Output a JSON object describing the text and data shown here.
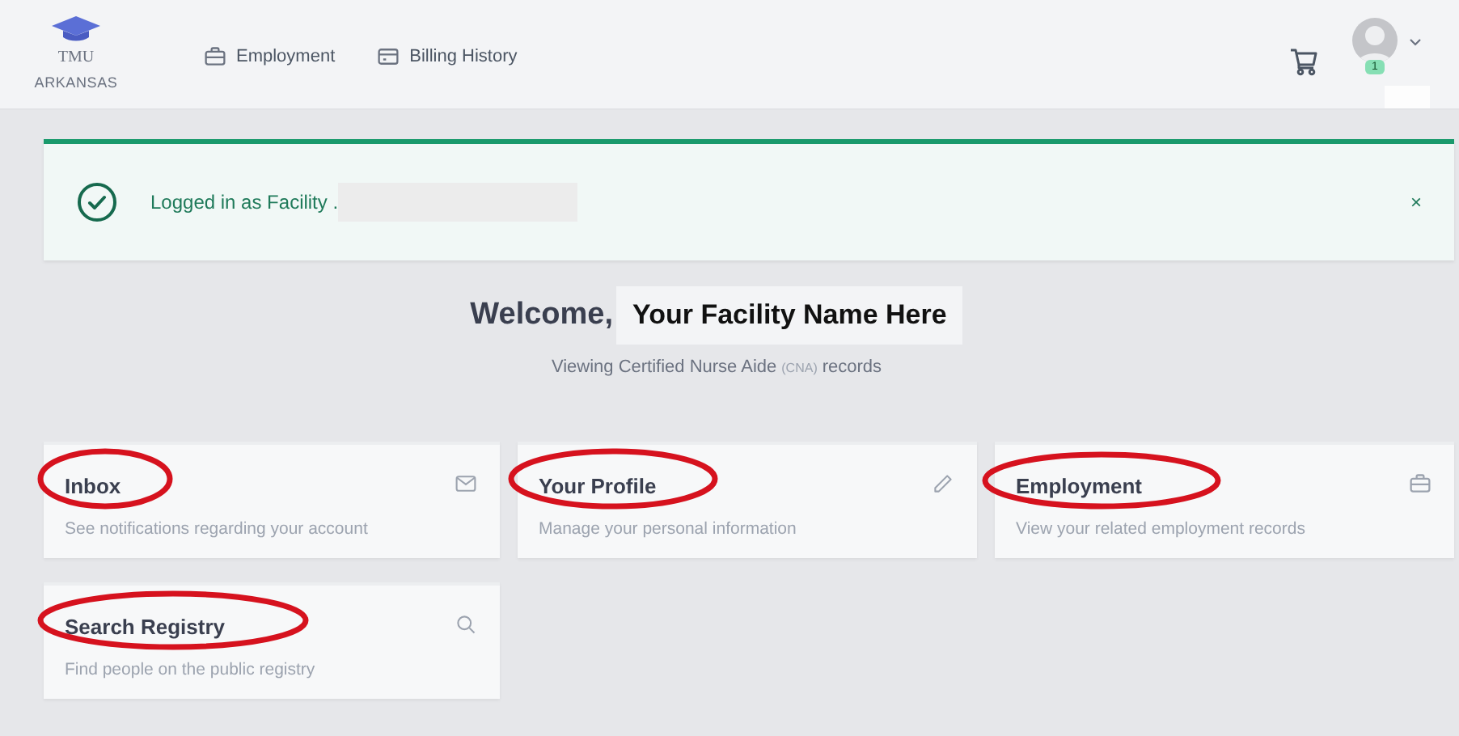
{
  "header": {
    "logo": {
      "title": "TMU",
      "subtitle": "ARKANSAS"
    },
    "nav": [
      {
        "label": "Employment"
      },
      {
        "label": "Billing History"
      }
    ],
    "notifications_badge": "1"
  },
  "alert": {
    "message": "Logged in as Facility .",
    "close_label": "×"
  },
  "welcome": {
    "greeting": "Welcome,",
    "name": "Your Facility Name Here",
    "subtitle_before": "Viewing Certified Nurse Aide",
    "subtitle_abbr": "(CNA)",
    "subtitle_after": "records"
  },
  "cards": [
    {
      "title": "Inbox",
      "description": "See notifications regarding your account",
      "circled": true
    },
    {
      "title": "Your Profile",
      "description": "Manage your personal information",
      "circled": true
    },
    {
      "title": "Employment",
      "description": "View your related employment records",
      "circled": true
    },
    {
      "title": "Search Registry",
      "description": "Find people on the public registry",
      "circled": true
    }
  ]
}
